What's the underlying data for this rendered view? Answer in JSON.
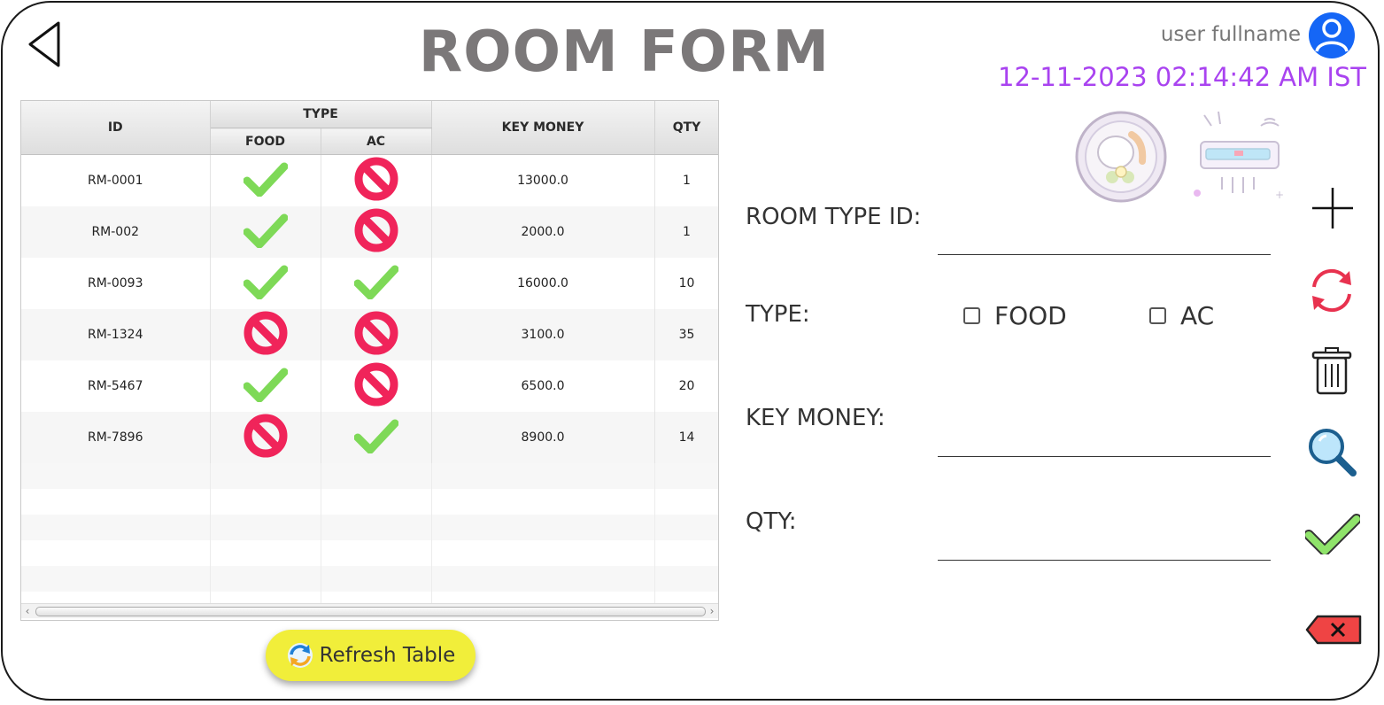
{
  "header": {
    "title": "ROOM FORM",
    "user_name": "user fullname",
    "datetime": "12-11-2023 02:14:42 AM IST"
  },
  "table": {
    "columns": {
      "id": "ID",
      "type": "TYPE",
      "food": "FOOD",
      "ac": "AC",
      "key_money": "KEY MONEY",
      "qty": "QTY"
    },
    "rows": [
      {
        "id": "RM-0001",
        "food": true,
        "ac": false,
        "key_money": "13000.0",
        "qty": "1"
      },
      {
        "id": "RM-002",
        "food": true,
        "ac": false,
        "key_money": "2000.0",
        "qty": "1"
      },
      {
        "id": "RM-0093",
        "food": true,
        "ac": true,
        "key_money": "16000.0",
        "qty": "10"
      },
      {
        "id": "RM-1324",
        "food": false,
        "ac": false,
        "key_money": "3100.0",
        "qty": "35"
      },
      {
        "id": "RM-5467",
        "food": true,
        "ac": false,
        "key_money": "6500.0",
        "qty": "20"
      },
      {
        "id": "RM-7896",
        "food": false,
        "ac": true,
        "key_money": "8900.0",
        "qty": "14"
      }
    ],
    "refresh_label": "Refresh Table"
  },
  "form": {
    "room_type_id_label": "ROOM TYPE ID:",
    "room_type_id_value": "",
    "type_label": "TYPE:",
    "food_label": "FOOD",
    "ac_label": "AC",
    "food_checked": false,
    "ac_checked": false,
    "key_money_label": "KEY MONEY:",
    "key_money_value": "",
    "qty_label": "QTY:",
    "qty_value": ""
  },
  "icons": {
    "back": "back-triangle-icon",
    "avatar": "user-avatar-icon",
    "food_image": "food-plate-icon",
    "ac_image": "air-conditioner-icon",
    "add": "plus-icon",
    "refresh": "refresh-icon",
    "delete": "trash-icon",
    "search": "search-icon",
    "save": "check-icon",
    "clear": "backspace-icon"
  },
  "colors": {
    "title": "#7b7879",
    "datetime": "#a943f0",
    "avatar": "#1566f6",
    "refresh_button": "#f1ee3a",
    "check": "#7ed957",
    "forbid": "#f0245a",
    "clear_icon": "#ef4444"
  }
}
